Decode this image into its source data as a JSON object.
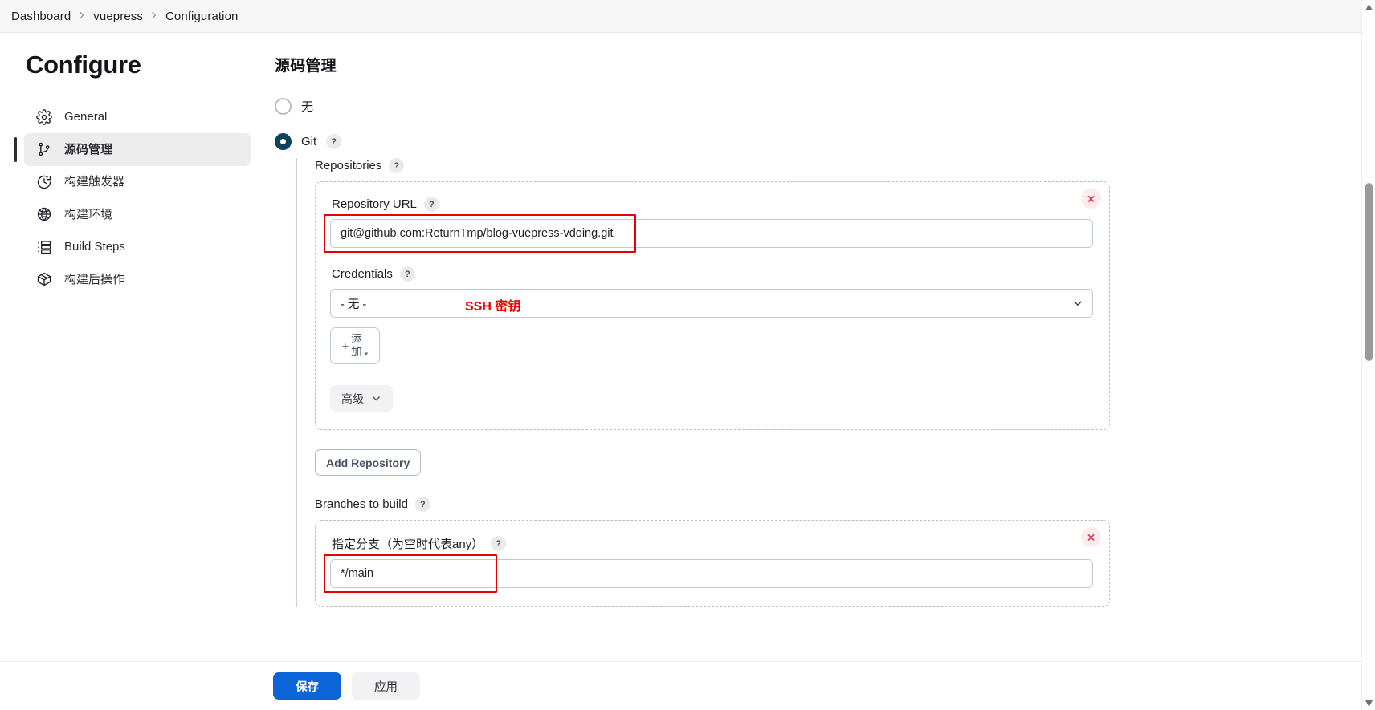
{
  "breadcrumb": {
    "items": [
      {
        "label": "Dashboard"
      },
      {
        "label": "vuepress"
      },
      {
        "label": "Configuration"
      }
    ]
  },
  "sidebar": {
    "title": "Configure",
    "items": [
      {
        "label": "General",
        "icon": "gear-icon",
        "active": false
      },
      {
        "label": "源码管理",
        "icon": "source-control-icon",
        "active": true
      },
      {
        "label": "构建触发器",
        "icon": "clock-icon",
        "active": false
      },
      {
        "label": "构建环境",
        "icon": "globe-icon",
        "active": false
      },
      {
        "label": "Build Steps",
        "icon": "list-icon",
        "active": false
      },
      {
        "label": "构建后操作",
        "icon": "package-icon",
        "active": false
      }
    ]
  },
  "main": {
    "section_title": "源码管理",
    "scm_options": [
      {
        "label": "无",
        "selected": false,
        "help": false
      },
      {
        "label": "Git",
        "selected": true,
        "help": true
      }
    ],
    "help_badge": "?",
    "repositories": {
      "label": "Repositories",
      "repo_url": {
        "label": "Repository URL",
        "value": "git@github.com:ReturnTmp/blog-vuepress-vdoing.git"
      },
      "credentials": {
        "label": "Credentials",
        "value": "- 无 -",
        "annotation": "SSH 密钥",
        "add_button": {
          "plus": "+",
          "label_line1": "添",
          "label_line2": "加",
          "caret": "▾"
        }
      },
      "advanced_button": "高级",
      "delete_button": "✕"
    },
    "add_repository_button": "Add Repository",
    "branches": {
      "label": "Branches to build",
      "specifier": {
        "label": "指定分支（为空时代表any）",
        "value": "*/main"
      },
      "delete_button": "✕"
    }
  },
  "footer": {
    "save_label": "保存",
    "apply_label": "应用"
  },
  "colors": {
    "primary_blue": "#0b65d8",
    "radio_selected": "#11405f",
    "annotation_red": "#e60000",
    "delete_red": "#e3203c",
    "sidebar_active_bg": "#ececed"
  }
}
